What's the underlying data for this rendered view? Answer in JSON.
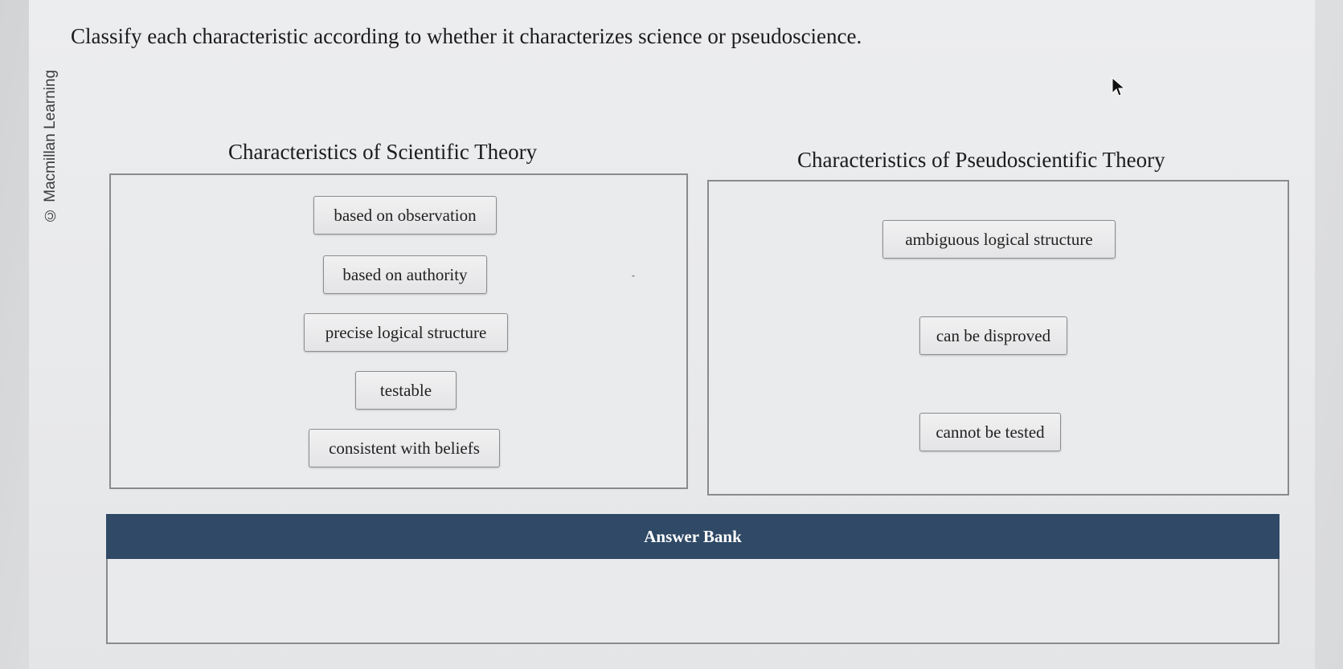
{
  "watermark": "© Macmillan Learning",
  "question": "Classify each characteristic according to whether it characterizes science or pseudoscience.",
  "columns": {
    "scientific": {
      "heading": "Characteristics of Scientific Theory",
      "items": [
        "based on observation",
        "based on authority",
        "precise logical structure",
        "testable",
        "consistent with beliefs"
      ]
    },
    "pseudoscientific": {
      "heading": "Characteristics of Pseudoscientific Theory",
      "items": [
        "ambiguous logical structure",
        "can be disproved",
        "cannot be tested"
      ]
    }
  },
  "answer_bank": {
    "label": "Answer Bank",
    "items": []
  },
  "colors": {
    "bank_header": "#2f4966",
    "chip_border": "#8c8d8f",
    "zone_border": "#8a8b8d"
  },
  "icons": {
    "cursor": "mouse-pointer-icon"
  }
}
